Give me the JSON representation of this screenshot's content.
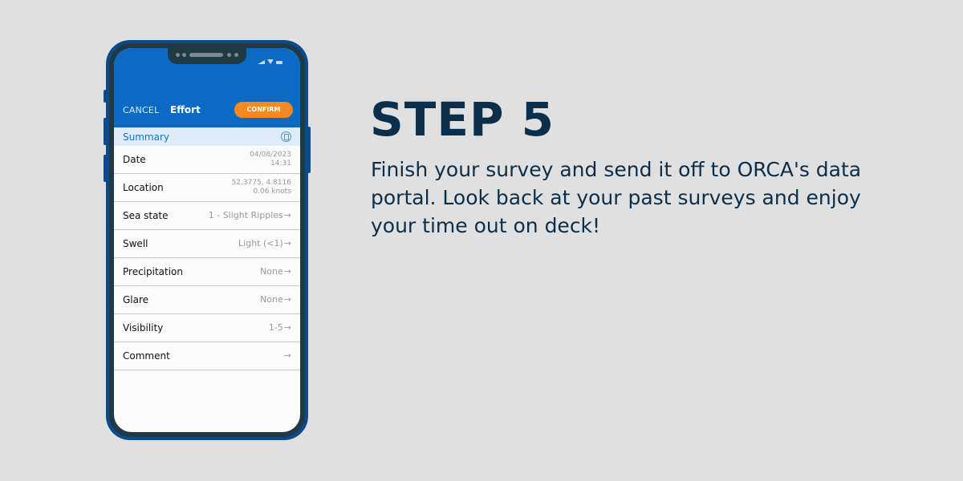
{
  "phone": {
    "header": {
      "cancel_label": "CANCEL",
      "title": "Effort",
      "confirm_label": "CONFIRM"
    },
    "summary": {
      "label": "Summary",
      "icon": "summary-doc-icon"
    },
    "rows": [
      {
        "label": "Date",
        "value_line1": "04/08/2023",
        "value_line2": "14:31"
      },
      {
        "label": "Location",
        "value_line1": "52.3775, 4.8116",
        "value_line2": "0.06 knots"
      },
      {
        "label": "Sea state",
        "value": "1 - Slight Ripples",
        "arrow": "→"
      },
      {
        "label": "Swell",
        "value": "Light (<1)",
        "arrow": "→"
      },
      {
        "label": "Precipitation",
        "value": "None",
        "arrow": "→"
      },
      {
        "label": "Glare",
        "value": "None",
        "arrow": "→"
      },
      {
        "label": "Visibility",
        "value": "1-5",
        "arrow": "→"
      },
      {
        "label": "Comment",
        "value": "",
        "arrow": "→"
      }
    ]
  },
  "step": {
    "title": "STEP 5",
    "description": "Finish your survey and send it off to ORCA's data portal. Look back at your past surveys and enjoy your time out on deck!"
  },
  "colors": {
    "background": "#e0e0e0",
    "header_blue": "#0a6ac4",
    "confirm_orange": "#f7891f",
    "summary_bg": "#deebf9",
    "text_navy": "#0b2e4a"
  }
}
